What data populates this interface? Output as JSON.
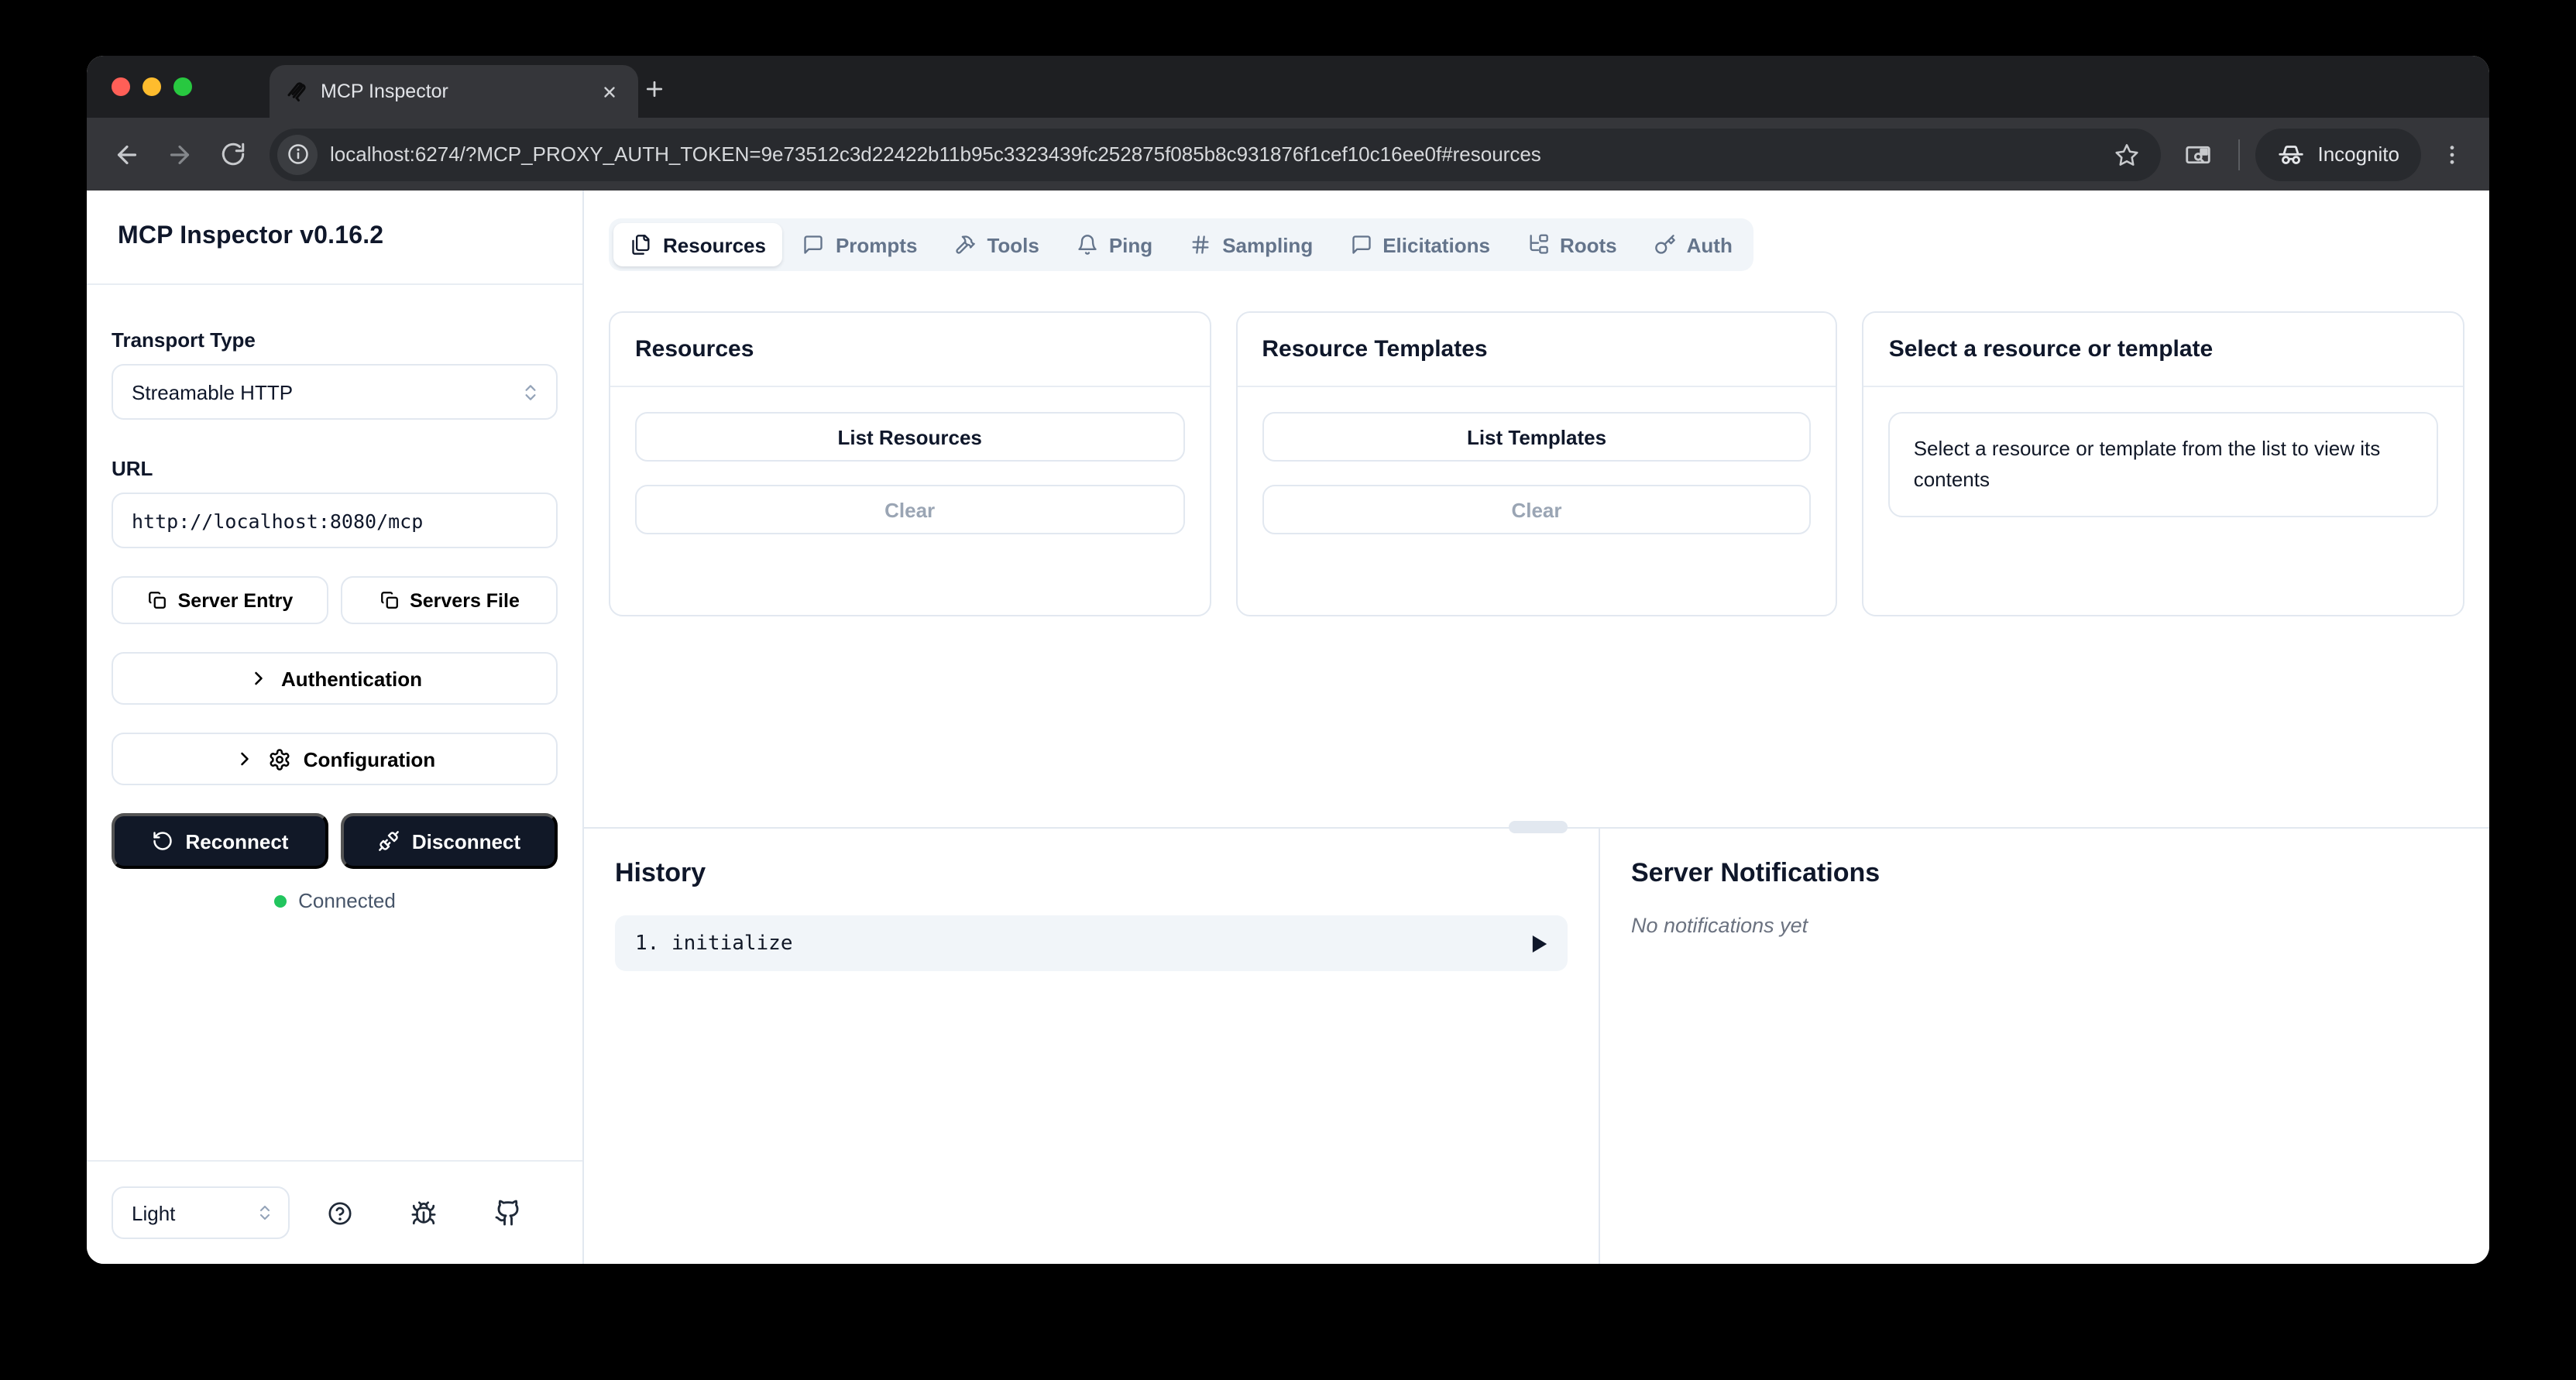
{
  "browser": {
    "tab_title": "MCP Inspector",
    "url": "localhost:6274/?MCP_PROXY_AUTH_TOKEN=9e73512c3d22422b11b95c3323439fc252875f085b8c931876f1cef10c16ee0f#resources",
    "incognito_label": "Incognito",
    "traffic_colors": {
      "close": "#ff5f57",
      "minimize": "#febc2e",
      "zoom": "#28c840"
    }
  },
  "sidebar": {
    "title": "MCP Inspector v0.16.2",
    "transport": {
      "label": "Transport Type",
      "value": "Streamable HTTP"
    },
    "url_field": {
      "label": "URL",
      "value": "http://localhost:8080/mcp"
    },
    "buttons": {
      "server_entry": "Server Entry",
      "servers_file": "Servers File",
      "authentication": "Authentication",
      "configuration": "Configuration",
      "reconnect": "Reconnect",
      "disconnect": "Disconnect"
    },
    "status": {
      "label": "Connected",
      "color": "#22c55e"
    },
    "footer": {
      "theme_value": "Light"
    }
  },
  "tabs": [
    {
      "label": "Resources",
      "icon": "files-icon",
      "active": true
    },
    {
      "label": "Prompts",
      "icon": "message-square-icon",
      "active": false
    },
    {
      "label": "Tools",
      "icon": "hammer-icon",
      "active": false
    },
    {
      "label": "Ping",
      "icon": "bell-icon",
      "active": false
    },
    {
      "label": "Sampling",
      "icon": "hash-icon",
      "active": false
    },
    {
      "label": "Elicitations",
      "icon": "message-square-icon",
      "active": false
    },
    {
      "label": "Roots",
      "icon": "tree-icon",
      "active": false
    },
    {
      "label": "Auth",
      "icon": "key-icon",
      "active": false
    }
  ],
  "panels": {
    "resources": {
      "title": "Resources",
      "list_button": "List Resources",
      "clear_button": "Clear"
    },
    "templates": {
      "title": "Resource Templates",
      "list_button": "List Templates",
      "clear_button": "Clear"
    },
    "detail": {
      "title": "Select a resource or template",
      "message": "Select a resource or template from the list to view its contents"
    }
  },
  "history": {
    "title": "History",
    "items": [
      {
        "text": "1. initialize"
      }
    ]
  },
  "notifications": {
    "title": "Server Notifications",
    "empty": "No notifications yet"
  }
}
